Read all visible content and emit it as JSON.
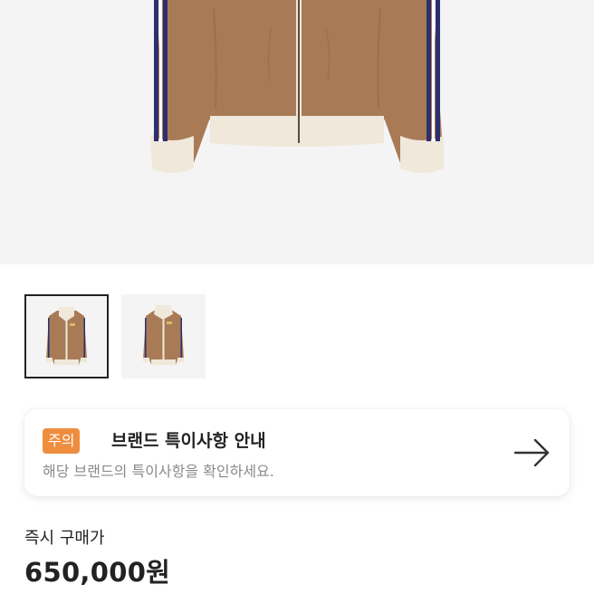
{
  "product_image": {
    "icon": "track-jacket-image",
    "colors": {
      "body": "#a87b56",
      "cuff": "#efe8db",
      "stripe_dark": "#2e2f6e",
      "stripe_light": "#ffffff",
      "background": "#f4f4f4"
    }
  },
  "thumbnails": [
    {
      "icon": "jacket-thumbnail-front",
      "selected": true
    },
    {
      "icon": "jacket-thumbnail-alt",
      "selected": false
    }
  ],
  "notice": {
    "badge": "주의",
    "title": "브랜드 특이사항 안내",
    "subtitle": "해당 브랜드의 특이사항을 확인하세요.",
    "arrow_icon": "arrow-right-icon",
    "badge_color": "#ef8d3e"
  },
  "price": {
    "label": "즉시 구매가",
    "value": "650,000원"
  }
}
